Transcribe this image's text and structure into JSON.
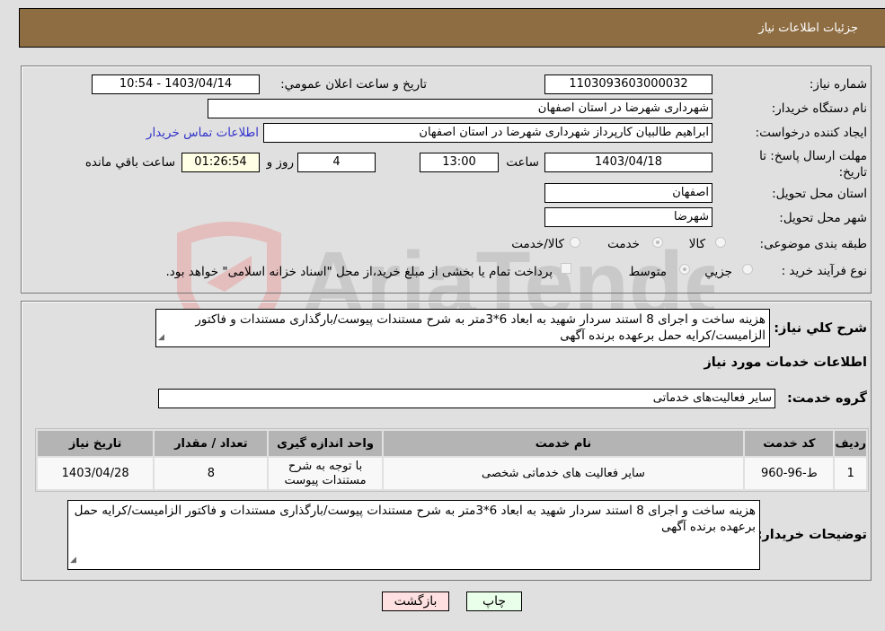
{
  "header": {
    "title": "جزئيات اطلاعات نياز"
  },
  "form": {
    "need_number": {
      "label": "شماره نياز:",
      "value": "1103093603000032"
    },
    "announce_datetime": {
      "label": "تاريخ و ساعت اعلان عمومي:",
      "value": "1403/04/14 - 10:54"
    },
    "buyer_org": {
      "label": "نام دستگاه خريدار:",
      "value": "شهرداری شهرضا در استان اصفهان"
    },
    "requester": {
      "label": "ايجاد کننده درخواست:",
      "value": "ابراهيم طالبيان کارپرداز شهرداری شهرضا در استان اصفهان"
    },
    "buyer_contact_link": "اطلاعات تماس خريدار",
    "deadline": {
      "label_line1": "مهلت ارسال پاسخ: تا",
      "label_line2": "تاريخ:",
      "date": "1403/04/18",
      "time_label": "ساعت",
      "time": "13:00",
      "days": "4",
      "days_label": "روز و",
      "remaining": "01:26:54",
      "remaining_label": "ساعت باقي مانده"
    },
    "delivery_province": {
      "label": "استان محل تحويل:",
      "value": "اصفهان"
    },
    "delivery_city": {
      "label": "شهر محل تحويل:",
      "value": "شهرضا"
    },
    "category": {
      "label": "طبقه بندی موضوعی:",
      "options": [
        "کالا",
        "خدمت",
        "کالا/خدمت"
      ],
      "selected": "خدمت"
    },
    "purchase_type": {
      "label": "نوع فرآيند خريد :",
      "options": [
        "جزيي",
        "متوسط"
      ],
      "selected": "متوسط",
      "treasury_note": "پرداخت تمام يا بخشی از مبلغ خريد،از محل \"اسناد خزانه اسلامی\" خواهد بود."
    }
  },
  "description": {
    "label": "شرح کلي نياز:",
    "value": "هزينه ساخت و اجرای 8 استند سردار شهيد به ابعاد 6*3متر به شرح مستندات پيوست/بارگذاری مستندات و فاکتور الزاميست/کرايه حمل برعهده برنده آگهی"
  },
  "services_section_title": "اطلاعات خدمات مورد نياز",
  "service_group": {
    "label": "گروه خدمت:",
    "value": "ساير فعاليت‌های خدماتی"
  },
  "table": {
    "headers": [
      "رديف",
      "کد خدمت",
      "نام خدمت",
      "واحد اندازه گيری",
      "تعداد / مقدار",
      "تاريخ نياز"
    ],
    "rows": [
      [
        "1",
        "ط-96-960",
        "ساير فعاليت های خدماتی شخصی",
        "با توجه به شرح مستندات پيوست",
        "8",
        "1403/04/28"
      ]
    ]
  },
  "buyer_notes": {
    "label": "توضيحات خريدار:",
    "value": "هزينه ساخت و اجرای 8 استند سردار شهيد به ابعاد 6*3متر به شرح مستندات پيوست/بارگذاری مستندات و فاکتور الزاميست/کرايه حمل برعهده برنده آگهی"
  },
  "buttons": {
    "print": "چاپ",
    "back": "بازگشت"
  },
  "watermark": {
    "text": "AriaTender.neT"
  },
  "colors": {
    "header_bg": "#8e6d42",
    "print_bg": "#eaffea",
    "back_bg": "#ffe0e0",
    "link": "#3333cc",
    "remaining_bg": "#ffffe6"
  }
}
